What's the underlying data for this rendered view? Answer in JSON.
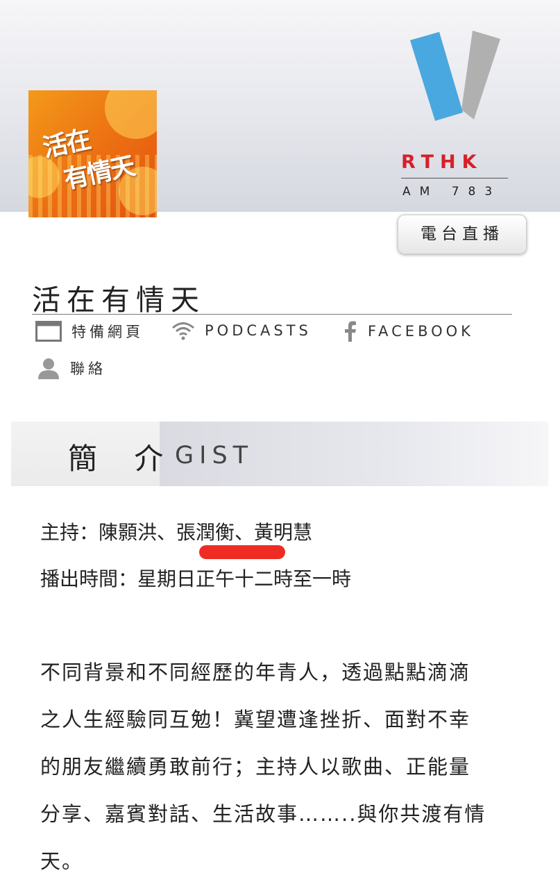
{
  "header": {
    "show_art_text_line1": "活在",
    "show_art_text_line2": "有情天",
    "station_name": "RTHK",
    "station_freq": "AM 783",
    "live_button_label": "電台直播"
  },
  "show": {
    "title": "活在有情天"
  },
  "links": [
    {
      "label": "特備網頁",
      "icon": "webpage-icon"
    },
    {
      "label": "PODCASTS",
      "icon": "wifi-podcast-icon"
    },
    {
      "label": "FACEBOOK",
      "icon": "facebook-icon"
    },
    {
      "label": "聯絡",
      "icon": "contact-person-icon"
    }
  ],
  "section": {
    "label_cn": "簡 介",
    "label_en": "GIST"
  },
  "info": {
    "hosts": "主持：陳顥洪、張潤衡、黃明慧",
    "airtime": "播出時間：星期日正午十二時至一時"
  },
  "description_lines": [
    "不同背景和不同經歷的年青人，透過點點滴滴",
    "之人生經驗同互勉！冀望遭逢挫折、面對不幸",
    "的朋友繼續勇敢前行；主持人以歌曲、正能量",
    "分享、嘉賓對話、生活故事……..與你共渡有情",
    "天。"
  ],
  "colors": {
    "rthk_red": "#d6202a",
    "v_blue": "#4aa8e0",
    "v_gray": "#b0b0b0",
    "highlight_red": "#ee2c24"
  }
}
